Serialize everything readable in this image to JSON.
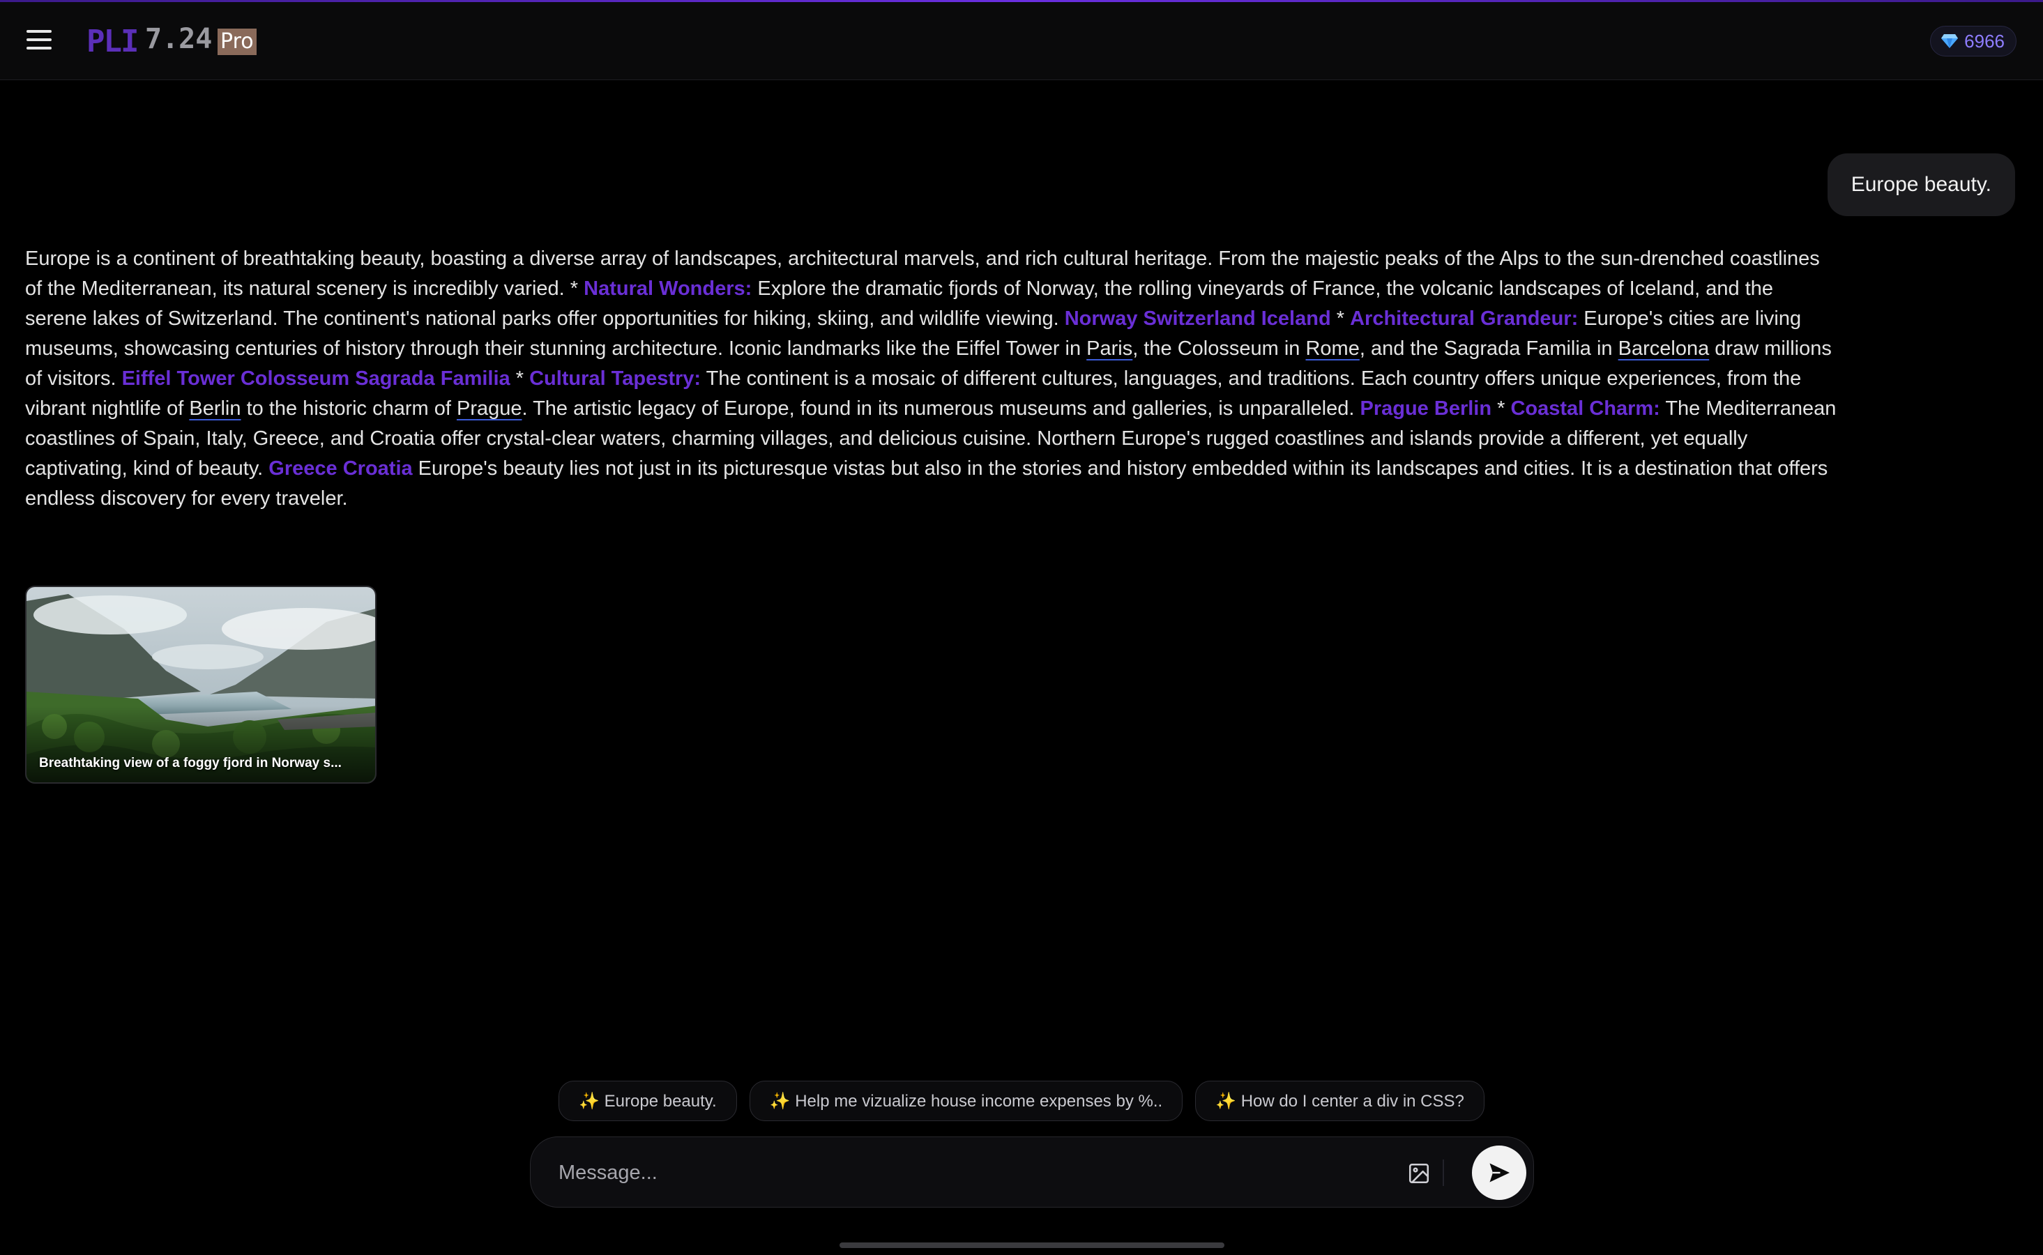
{
  "header": {
    "logo_text": "PLI",
    "version": "7.24",
    "badge": "Pro",
    "credits": "6966",
    "accent_color": "#6a2fd6"
  },
  "conversation": {
    "user_message": "Europe beauty.",
    "answer": {
      "p1": "Europe is a continent of breathtaking beauty, boasting a diverse array of landscapes, architectural marvels, and rich cultural heritage. From the majestic peaks of the Alps to the sun-drenched coastlines of the Mediterranean, its natural scenery is incredibly varied. * ",
      "h1": "Natural Wonders:",
      "p2": " Explore the dramatic fjords of Norway, the rolling vineyards of France, the volcanic landscapes of Iceland, and the serene lakes of Switzerland. The continent's national parks offer opportunities for hiking, skiing, and wildlife viewing. ",
      "tags1": "Norway Switzerland Iceland",
      "sep1": " * ",
      "h2": "Architectural Grandeur:",
      "p3": " Europe's cities are living museums, showcasing centuries of history through their stunning architecture. Iconic landmarks like the Eiffel Tower in ",
      "link_paris": "Paris",
      "p4": ", the Colosseum in ",
      "link_rome": "Rome",
      "p5": ", and the Sagrada Familia in ",
      "link_barcelona": "Barcelona",
      "p6": " draw millions of visitors. ",
      "tags2": "Eiffel Tower Colosseum Sagrada Familia",
      "sep2": " * ",
      "h3": "Cultural Tapestry:",
      "p7": " The continent is a mosaic of different cultures, languages, and traditions. Each country offers unique experiences, from the vibrant nightlife of ",
      "link_berlin": "Berlin",
      "p8": " to the historic charm of ",
      "link_prague": "Prague",
      "p9": ". The artistic legacy of Europe, found in its numerous museums and galleries, is unparalleled. ",
      "tags3": "Prague Berlin",
      "sep3": " * ",
      "h4": "Coastal Charm:",
      "p10": " The Mediterranean coastlines of Spain, Italy, Greece, and Croatia offer crystal-clear waters, charming villages, and delicious cuisine. Northern Europe's rugged coastlines and islands provide a different, yet equally captivating, kind of beauty. ",
      "tags4": "Greece Croatia",
      "p11": " Europe's beauty lies not just in its picturesque vistas but also in the stories and history embedded within its landscapes and cities. It is a destination that offers endless discovery for every traveler."
    },
    "image_caption": "Breathtaking view of a foggy fjord in Norway s..."
  },
  "suggestions": [
    "✨ Europe beauty.",
    "✨ Help me vizualize house income expenses by %..",
    "✨ How do I center a div in CSS?"
  ],
  "composer": {
    "placeholder": "Message..."
  }
}
